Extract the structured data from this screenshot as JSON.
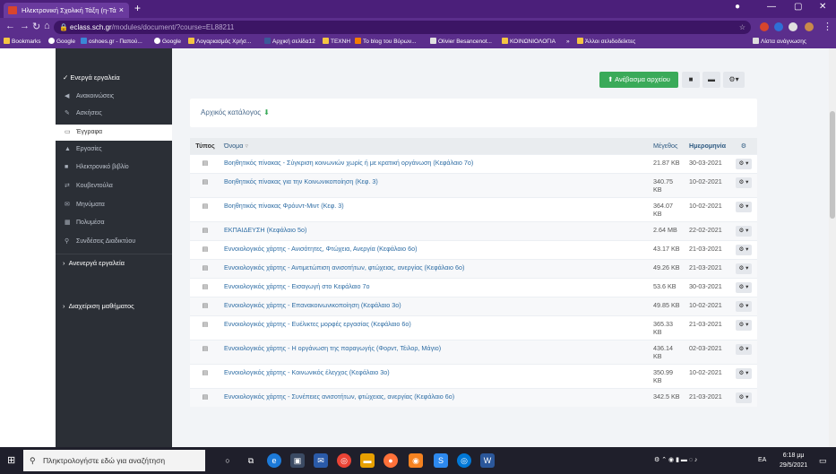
{
  "browser": {
    "tab_title": "Ηλεκτρονική Σχολική Τάξη (η-Τά",
    "tab_close": "×",
    "new_tab": "+",
    "url_domain": "eclass.sch.gr",
    "url_path": "/modules/document/?course=EL88211",
    "bookmarks": [
      "Bookmarks",
      "Google",
      "oshoes.gr - Παπού...",
      "Google",
      "Λογαριασμός Χρήσ...",
      "Αρχική σελίδα12",
      "ΤΕΧΝΗ",
      "To blog του Βύρων...",
      "Olivier Besancenot...",
      "ΚΟΙΝΩΝΙΟΛΟΓΙΑ",
      "»",
      "Άλλοι σελιδοδείκτες",
      "Λίστα ανάγνωσης"
    ]
  },
  "sidebar": {
    "active_tools_label": "Ενεργά εργαλεία",
    "items": [
      {
        "label": "Ανακοινώσεις",
        "icon": "megaphone-icon"
      },
      {
        "label": "Ασκήσεις",
        "icon": "edit-icon"
      },
      {
        "label": "Έγγραφα",
        "icon": "folder-open-icon"
      },
      {
        "label": "Εργασίες",
        "icon": "flask-icon"
      },
      {
        "label": "Ηλεκτρονικό βιβλίο",
        "icon": "book-icon"
      },
      {
        "label": "Κουβεντούλα",
        "icon": "exchange-icon"
      },
      {
        "label": "Μηνύματα",
        "icon": "envelope-icon"
      },
      {
        "label": "Πολυμέσα",
        "icon": "film-icon"
      },
      {
        "label": "Συνδέσεις Διαδικτύου",
        "icon": "link-icon"
      }
    ],
    "inactive_tools_label": "Ανενεργά εργαλεία",
    "course_admin_label": "Διαχείριση μαθήματος"
  },
  "toolbar": {
    "upload_label": "Ανέβασμα αρχείου"
  },
  "breadcrumb": {
    "root_label": "Αρχικός κατάλογος"
  },
  "table": {
    "headers": {
      "type": "Τύπος",
      "name": "Όνομα",
      "size": "Μέγεθος",
      "date": "Ημερομηνία"
    },
    "rows": [
      {
        "name": "Βοηθητικός πίνακας - Σύγκριση κοινωνιών χωρίς ή με κρατική οργάνωση (Κεφάλαιο 7ο)",
        "size": "21.87 KB",
        "date": "30-03-2021"
      },
      {
        "name": "Βοηθητικός πίνακας για την Κοινωνικοποίηση (Κεφ. 3)",
        "size": "340.75 KB",
        "date": "10-02-2021"
      },
      {
        "name": "Βοηθητικός πίνακας Φρόυντ-Μιντ (Κεφ. 3)",
        "size": "364.07 KB",
        "date": "10-02-2021"
      },
      {
        "name": "ΕΚΠΑΙΔΕΥΣΗ (Κεφάλαιο 5ο)",
        "size": "2.64 MB",
        "date": "22-02-2021"
      },
      {
        "name": "Εννοιολογικός χάρτης - Ανισότητες, Φτώχεια, Ανεργία (Κεφάλαιο 6ο)",
        "size": "43.17 KB",
        "date": "21-03-2021"
      },
      {
        "name": "Εννοιολογικός χάρτης - Αντιμετώπιση ανισοτήτων, φτώχειας, ανεργίας (Κεφάλαιο 6ο)",
        "size": "49.26 KB",
        "date": "21-03-2021"
      },
      {
        "name": "Εννοιολογικός χάρτης - Εισαγωγή στο Κεφάλαιο 7ο",
        "size": "53.6 KB",
        "date": "30-03-2021"
      },
      {
        "name": "Εννοιολογικός χάρτης - Επανακοινωνικοποίηση (Κεφάλαιο 3ο)",
        "size": "49.85 KB",
        "date": "10-02-2021"
      },
      {
        "name": "Εννοιολογικός χάρτης - Ευέλικτες μορφές εργασίας (Κεφάλαιο 6ο)",
        "size": "365.33 KB",
        "date": "21-03-2021"
      },
      {
        "name": "Εννοιολογικός χάρτης - Η οργάνωση της παραγωγής (Φορντ, Τέιλορ, Μάγιο)",
        "size": "436.14 KB",
        "date": "02-03-2021"
      },
      {
        "name": "Εννοιολογικός χάρτης - Κοινωνικός έλεγχος (Κεφάλαιο 3ο)",
        "size": "350.99 KB",
        "date": "10-02-2021"
      },
      {
        "name": "Εννοιολογικός χάρτης - Συνέπειες ανισοτήτων, φτώχειας, ανεργίας (Κεφάλαιο 6ο)",
        "size": "342.5 KB",
        "date": "21-03-2021"
      }
    ]
  },
  "taskbar": {
    "search_placeholder": "Πληκτρολογήστε εδώ για αναζήτηση",
    "lang": "EA",
    "time": "6:18 μμ",
    "date": "29/5/2021"
  }
}
